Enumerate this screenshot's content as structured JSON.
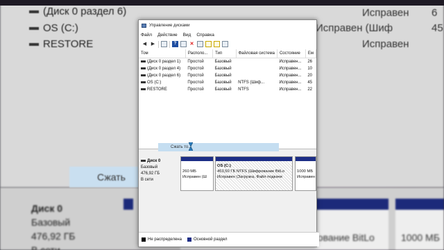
{
  "background": {
    "rows": [
      {
        "name": "(Диск 0 раздел 6)",
        "status": "Исправен"
      },
      {
        "name": "OS (C:)",
        "status": "Исправен (Шиф"
      },
      {
        "name": "RESTORE",
        "status": "Исправен"
      }
    ],
    "status_partial_top": "Исправен",
    "right_numbers": [
      "6",
      "45"
    ],
    "shrink_label": "Сжать",
    "disk_label": "Диск 0",
    "disk_type": "Базовый",
    "disk_size": "476,92 ГБ",
    "disk_online": "В сети",
    "lower_texts": [
      "рование BitLo",
      "1000 МБ"
    ]
  },
  "window": {
    "title": "Управление дисками",
    "menu": [
      "Файл",
      "Действие",
      "Вид",
      "Справка"
    ],
    "columns": [
      "Том",
      "Располо...",
      "Тип",
      "Файловая система",
      "Состояние",
      "Ем"
    ],
    "volumes": [
      {
        "name": "(Диск 0 раздел 1)",
        "layout": "Простой",
        "type": "Базовый",
        "fs": "",
        "status": "Исправен...",
        "cap": "26"
      },
      {
        "name": "(Диск 0 раздел 4)",
        "layout": "Простой",
        "type": "Базовый",
        "fs": "",
        "status": "Исправен...",
        "cap": "10"
      },
      {
        "name": "(Диск 0 раздел 6)",
        "layout": "Простой",
        "type": "Базовый",
        "fs": "",
        "status": "Исправен...",
        "cap": "20"
      },
      {
        "name": "OS (C:)",
        "layout": "Простой",
        "type": "Базовый",
        "fs": "NTFS (Шиф...",
        "status": "Исправен...",
        "cap": "45"
      },
      {
        "name": "RESTORE",
        "layout": "Простой",
        "type": "Базовый",
        "fs": "NTFS",
        "status": "Исправен...",
        "cap": "22"
      }
    ],
    "context_menu_item": "Сжать то...",
    "disk": {
      "label": "Диск 0",
      "type": "Базовый",
      "size": "476,92 ГБ",
      "state": "В сети"
    },
    "partitions": [
      {
        "line1": "260 МБ",
        "line2": "Исправен (Ш"
      },
      {
        "title": "OS (C:)",
        "line1": "453,50 ГБ NTFS (Шифрование BitLo",
        "line2": "Исправен (Загрузка, Файл подкачи"
      },
      {
        "line1": "1000 МБ",
        "line2": "Исправен"
      }
    ],
    "legend": [
      {
        "label": "Не распределена",
        "color": "#000000"
      },
      {
        "label": "Основной раздел",
        "color": "#1c2d86"
      }
    ]
  }
}
